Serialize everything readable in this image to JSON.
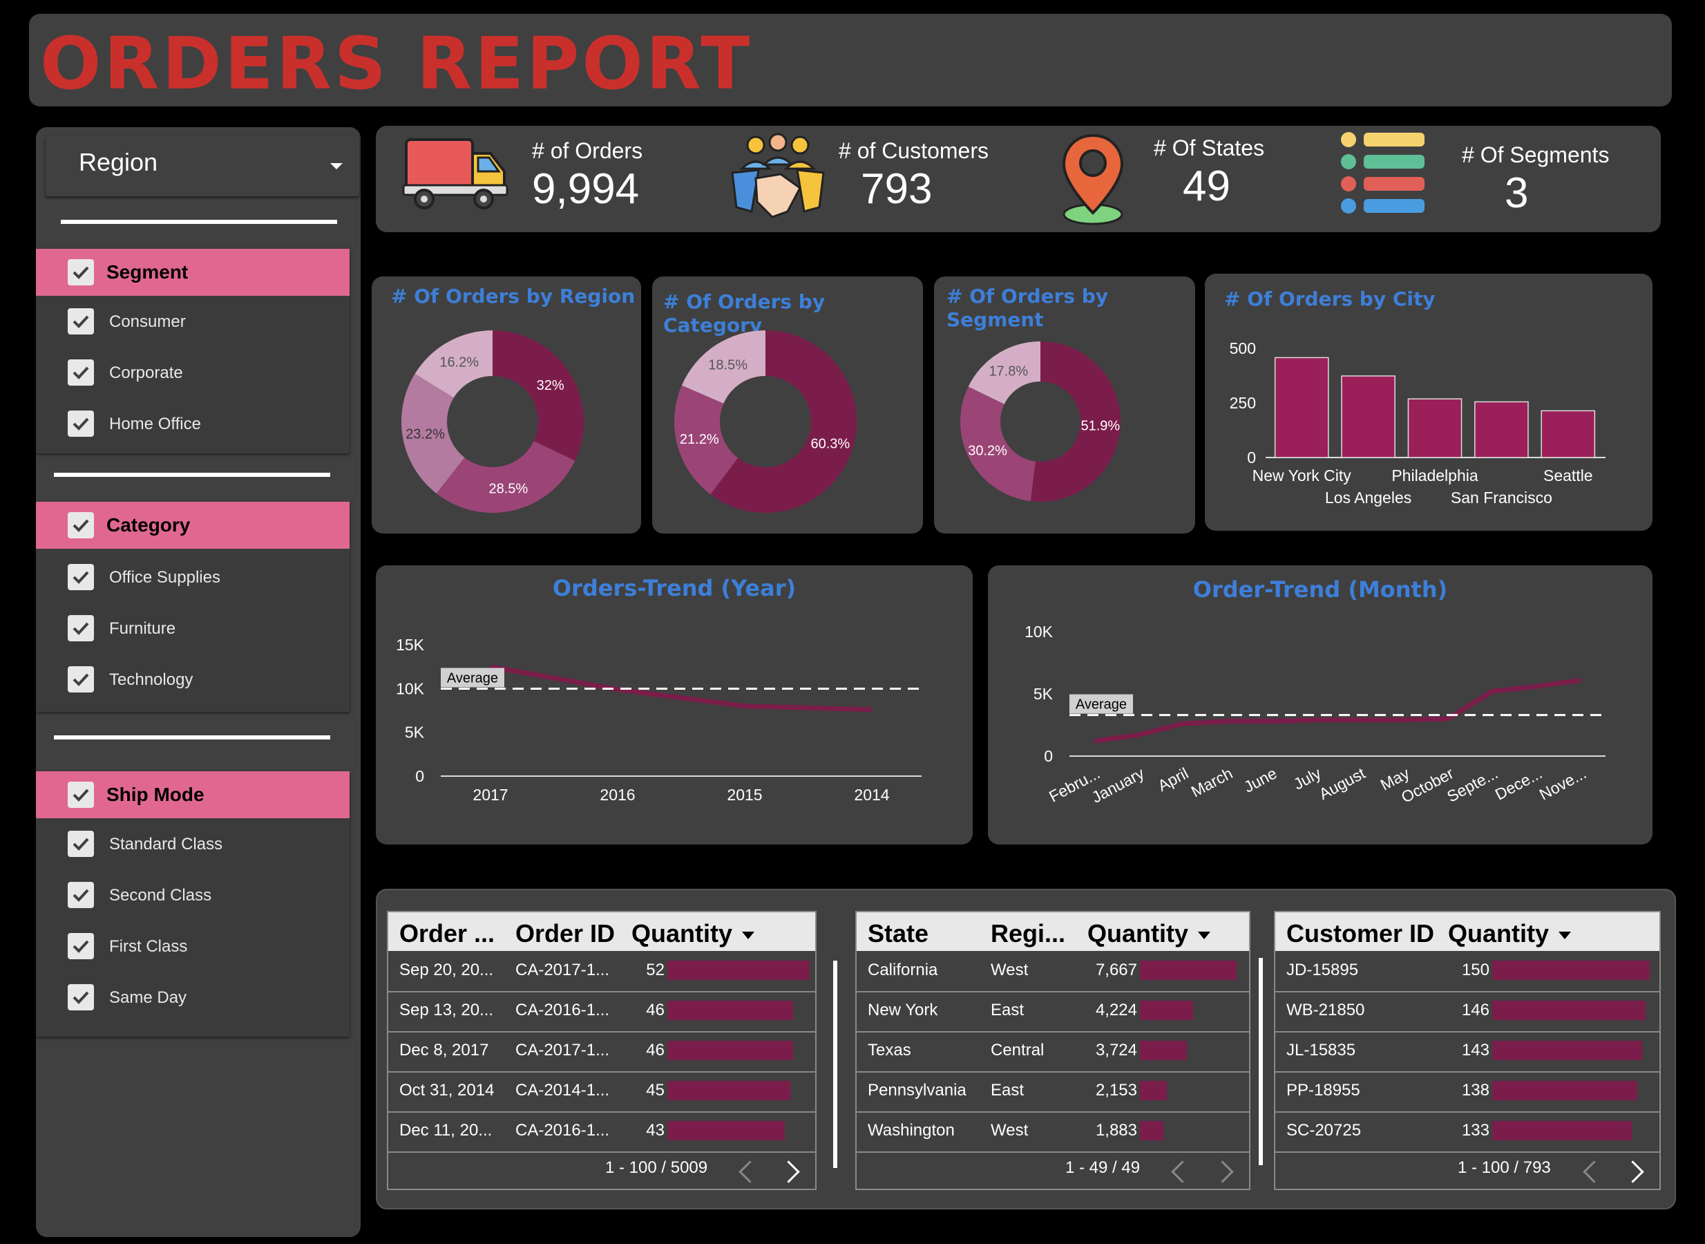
{
  "report": {
    "title": "ORDERS REPORT"
  },
  "sidebar": {
    "dropdown": {
      "label": "Region"
    },
    "segment": {
      "header": "Segment",
      "items": [
        "Consumer",
        "Corporate",
        "Home Office"
      ]
    },
    "category": {
      "header": "Category",
      "items": [
        "Office Supplies",
        "Furniture",
        "Technology"
      ]
    },
    "ship_mode": {
      "header": "Ship Mode",
      "items": [
        "Standard Class",
        "Second Class",
        "First Class",
        "Same Day"
      ]
    }
  },
  "kpis": {
    "orders": {
      "label": "# of Orders",
      "value": "9,994",
      "icon": "truck-icon"
    },
    "customers": {
      "label": "# of Customers",
      "value": "793",
      "icon": "handshake-icon"
    },
    "states": {
      "label": "# Of States",
      "value": "49",
      "icon": "map-pin-icon"
    },
    "segments": {
      "label": "# Of Segments",
      "value": "3",
      "icon": "list-icon"
    }
  },
  "colors": {
    "accent": "#7b1d4b",
    "title_red": "#c9302c",
    "chart_title_blue": "#3d7fd9",
    "filter_header": "#e06890"
  },
  "chart_data": [
    {
      "type": "pie",
      "title": "# Of Orders by Region",
      "donut": true,
      "labels": [
        "32%",
        "28.5%",
        "23.2%",
        "16.2%"
      ],
      "values": [
        32,
        28.5,
        23.2,
        16.2
      ],
      "colors": [
        "#7b1d4b",
        "#9b4577",
        "#b47ba0",
        "#d4aec6"
      ]
    },
    {
      "type": "pie",
      "title": "# Of Orders by Category",
      "donut": true,
      "labels": [
        "60.3%",
        "21.2%",
        "18.5%"
      ],
      "values": [
        60.3,
        21.2,
        18.5
      ],
      "colors": [
        "#7b1d4b",
        "#9b4577",
        "#d4aec6"
      ]
    },
    {
      "type": "pie",
      "title": "# Of Orders by Segment",
      "donut": true,
      "labels": [
        "51.9%",
        "30.2%",
        "17.8%"
      ],
      "values": [
        51.9,
        30.2,
        17.8
      ],
      "colors": [
        "#7b1d4b",
        "#9b4577",
        "#d4aec6"
      ]
    },
    {
      "type": "bar",
      "title": "# Of Orders by City",
      "categories": [
        "New York City",
        "Los Angeles",
        "Philadelphia",
        "San Francisco",
        "Seattle"
      ],
      "values": [
        915,
        747,
        537,
        510,
        428
      ],
      "ylim": [
        0,
        1000
      ],
      "yticks": [
        {
          "v": 0,
          "t": "0"
        },
        {
          "v": 500,
          "t": "250"
        },
        {
          "v": 1000,
          "t": "500"
        }
      ],
      "color": "#9b1f58"
    },
    {
      "type": "line",
      "title": "Orders-Trend  (Year)",
      "x": [
        "2017",
        "2016",
        "2015",
        "2014"
      ],
      "values": [
        12500,
        9900,
        8000,
        7600
      ],
      "average": 9990,
      "average_label": "Average",
      "ylim": [
        0,
        15000
      ],
      "yticks": [
        {
          "v": 0,
          "t": "0"
        },
        {
          "v": 5000,
          "t": "5K"
        },
        {
          "v": 10000,
          "t": "10K"
        },
        {
          "v": 15000,
          "t": "15K"
        }
      ],
      "color": "#7b1d4b"
    },
    {
      "type": "line",
      "title": "Order-Trend (Month)",
      "x": [
        "Febru...",
        "January",
        "April",
        "March",
        "June",
        "July",
        "August",
        "May",
        "October",
        "Septe...",
        "Dece...",
        "Nove..."
      ],
      "values": [
        1200,
        1700,
        2600,
        2800,
        2800,
        2900,
        2900,
        2900,
        3000,
        5200,
        5600,
        6100
      ],
      "average": 3300,
      "average_label": "Average",
      "ylim": [
        0,
        10000
      ],
      "yticks": [
        {
          "v": 0,
          "t": "0"
        },
        {
          "v": 5000,
          "t": "5K"
        },
        {
          "v": 10000,
          "t": "10K"
        }
      ],
      "color": "#7b1d4b"
    }
  ],
  "tables": {
    "orders": {
      "headers": [
        "Order ...",
        "Order ID",
        "Quantity"
      ],
      "rows": [
        {
          "date": "Sep 20, 20...",
          "id": "CA-2017-1...",
          "qty": 52
        },
        {
          "date": "Sep 13, 20...",
          "id": "CA-2016-1...",
          "qty": 46
        },
        {
          "date": "Dec 8, 2017",
          "id": "CA-2017-1...",
          "qty": 46
        },
        {
          "date": "Oct 31, 2014",
          "id": "CA-2014-1...",
          "qty": 45
        },
        {
          "date": "Dec 11, 20...",
          "id": "CA-2016-1...",
          "qty": 43
        }
      ],
      "max": 52,
      "pager": "1 - 100 / 5009"
    },
    "states": {
      "headers": [
        "State",
        "Regi...",
        "Quantity"
      ],
      "rows": [
        {
          "state": "California",
          "region": "West",
          "qty": "7,667",
          "n": 7667
        },
        {
          "state": "New York",
          "region": "East",
          "qty": "4,224",
          "n": 4224
        },
        {
          "state": "Texas",
          "region": "Central",
          "qty": "3,724",
          "n": 3724
        },
        {
          "state": "Pennsylvania",
          "region": "East",
          "qty": "2,153",
          "n": 2153
        },
        {
          "state": "Washington",
          "region": "West",
          "qty": "1,883",
          "n": 1883
        }
      ],
      "max": 7667,
      "pager": "1 - 49 / 49"
    },
    "customers": {
      "headers": [
        "Customer ID",
        "Quantity"
      ],
      "rows": [
        {
          "id": "JD-15895",
          "qty": 150
        },
        {
          "id": "WB-21850",
          "qty": 146
        },
        {
          "id": "JL-15835",
          "qty": 143
        },
        {
          "id": "PP-18955",
          "qty": 138
        },
        {
          "id": "SC-20725",
          "qty": 133
        }
      ],
      "max": 150,
      "pager": "1 - 100 / 793"
    }
  }
}
